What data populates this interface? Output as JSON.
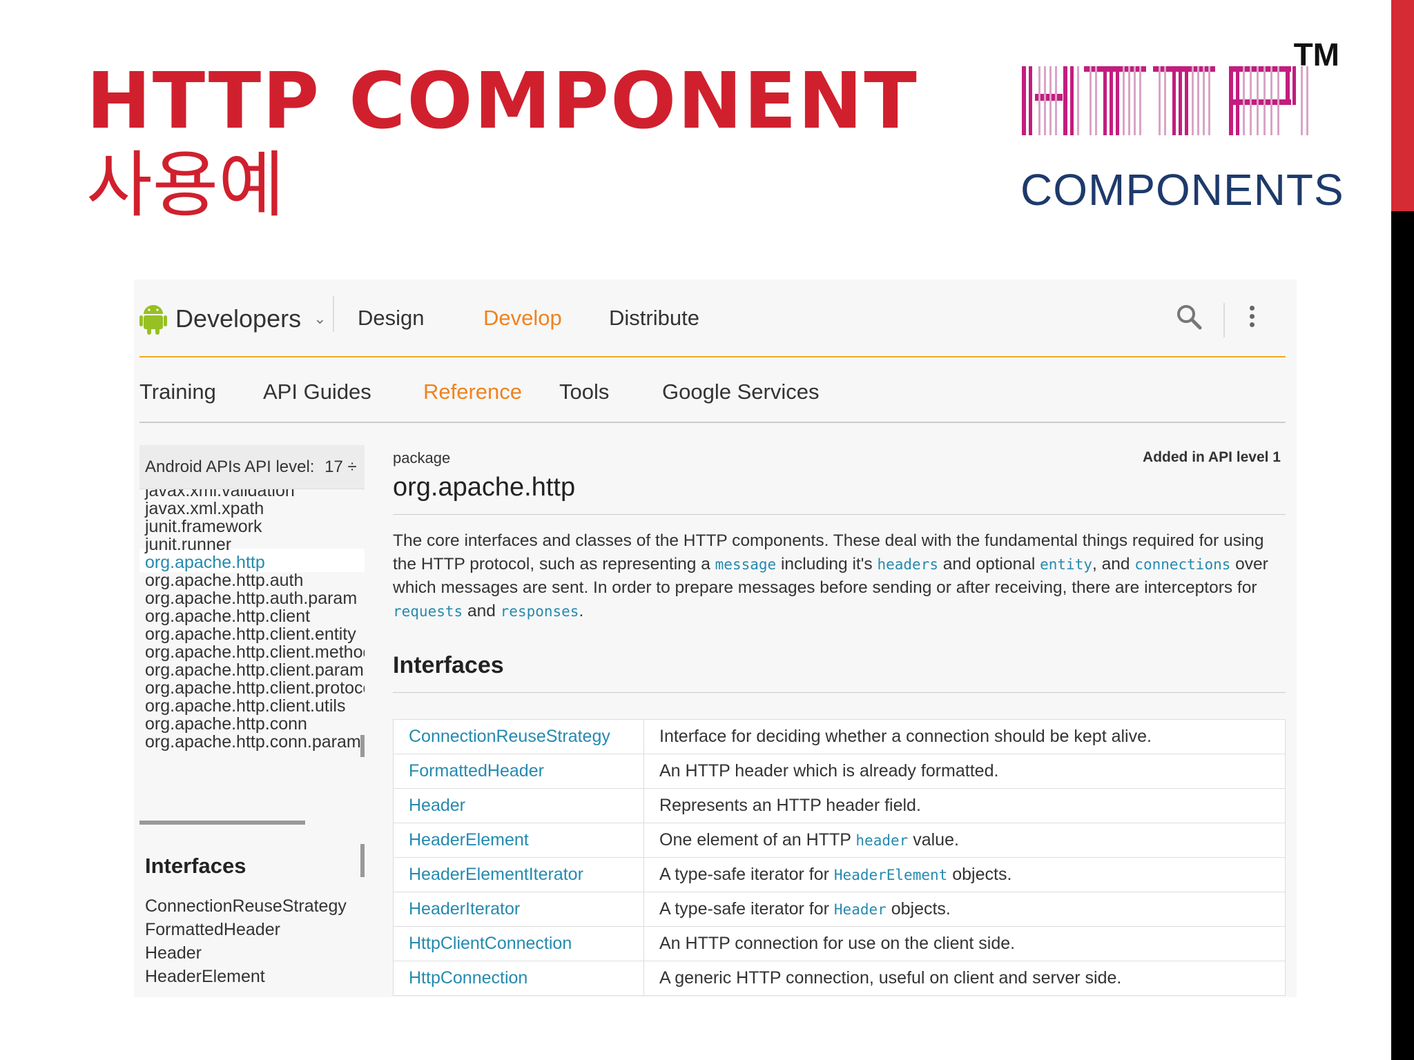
{
  "slide": {
    "title_line1": "HTTP COMPONENT",
    "title_line2": "사용예",
    "accent_color": "#d0202e"
  },
  "logo": {
    "tm": "TM",
    "components": "COMPONENTS",
    "mark_color": "#c21d7e"
  },
  "topnav": {
    "brand": "Developers",
    "items": [
      "Design",
      "Develop",
      "Distribute"
    ],
    "active": "Develop",
    "search_icon": "search-icon",
    "overflow_icon": "kebab-icon"
  },
  "subnav": {
    "items": [
      "Training",
      "API Guides",
      "Reference",
      "Tools",
      "Google Services"
    ],
    "active": "Reference"
  },
  "sidebar": {
    "api_selector_label": "Android APIs API level:",
    "api_level": "17 ÷",
    "packages": [
      "javax.xml.validation",
      "javax.xml.xpath",
      "junit.framework",
      "junit.runner",
      "org.apache.http",
      "org.apache.http.auth",
      "org.apache.http.auth.param",
      "org.apache.http.client",
      "org.apache.http.client.entity",
      "org.apache.http.client.methods",
      "org.apache.http.client.params",
      "org.apache.http.client.protocol",
      "org.apache.http.client.utils",
      "org.apache.http.conn",
      "org.apache.http.conn.params"
    ],
    "selected_package": "org.apache.http",
    "interfaces_heading": "Interfaces",
    "interfaces": [
      "ConnectionReuseStrategy",
      "FormattedHeader",
      "Header",
      "HeaderElement"
    ]
  },
  "main": {
    "package_label": "package",
    "added_in": "Added in API level 1",
    "package_name": "org.apache.http",
    "description": {
      "p1": "The core interfaces and classes of the HTTP components. These deal with the fundamental things required for using the HTTP protocol, such as representing a ",
      "c1": "message",
      "p2": " including it's ",
      "c2": "headers",
      "p3": " and optional ",
      "c3": "entity",
      "p4": ", and ",
      "c4": "connections",
      "p5": " over which messages are sent. In order to prepare messages before sending or after receiving, there are interceptors for ",
      "c5": "requests",
      "p6": " and ",
      "c6": "responses",
      "p7": "."
    },
    "interfaces_heading": "Interfaces",
    "interfaces": [
      {
        "name": "ConnectionReuseStrategy",
        "pre": "Interface for deciding whether a connection should be kept alive.",
        "code": "",
        "post": ""
      },
      {
        "name": "FormattedHeader",
        "pre": "An HTTP header which is already formatted.",
        "code": "",
        "post": ""
      },
      {
        "name": "Header",
        "pre": "Represents an HTTP header field.",
        "code": "",
        "post": ""
      },
      {
        "name": "HeaderElement",
        "pre": "One element of an HTTP ",
        "code": "header",
        "post": " value."
      },
      {
        "name": "HeaderElementIterator",
        "pre": "A type-safe iterator for ",
        "code": "HeaderElement",
        "post": " objects."
      },
      {
        "name": "HeaderIterator",
        "pre": "A type-safe iterator for ",
        "code": "Header",
        "post": " objects."
      },
      {
        "name": "HttpClientConnection",
        "pre": "An HTTP connection for use on the client side.",
        "code": "",
        "post": ""
      },
      {
        "name": "HttpConnection",
        "pre": "A generic HTTP connection, useful on client and server side.",
        "code": "",
        "post": ""
      }
    ]
  }
}
